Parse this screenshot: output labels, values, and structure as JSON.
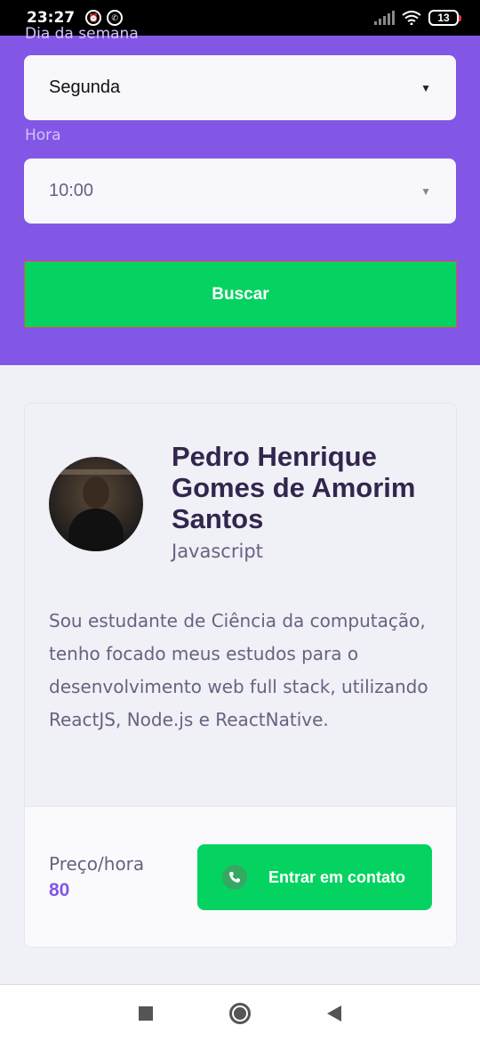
{
  "status_bar": {
    "time": "23:27",
    "battery": "13",
    "icons": [
      "alarm-icon",
      "whatsapp-icon",
      "signal-icon",
      "wifi-icon",
      "battery-icon"
    ]
  },
  "filters": {
    "day_label_partial": "Dia da semana",
    "day_value": "Segunda",
    "hour_label": "Hora",
    "hour_value": "10:00",
    "search_button": "Buscar"
  },
  "teacher": {
    "name": "Pedro Henrique Gomes de Amorim Santos",
    "subject": "Javascript",
    "bio": "Sou estudante de Ciência da computação, tenho focado meus estudos para o desenvolvimento web full stack, utilizando ReactJS, Node.js e ReactNative.",
    "price_label": "Preço/hora",
    "price_value": "80",
    "contact_button": "Entrar em contato"
  },
  "colors": {
    "primary": "#8257e5",
    "secondary": "#04d361",
    "title": "#32264d",
    "text": "#6a6180"
  },
  "nav": {
    "icons": [
      "recent-apps-icon",
      "home-icon",
      "back-icon"
    ]
  }
}
